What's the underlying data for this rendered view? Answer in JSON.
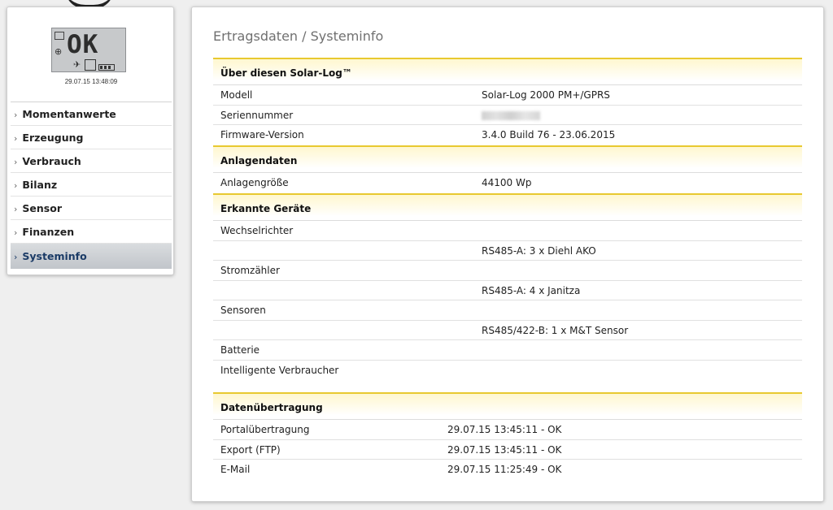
{
  "lcd": {
    "display_text": "OK",
    "timestamp": "29.07.15 13:48:09"
  },
  "nav": {
    "items": [
      {
        "label": "Momentanwerte"
      },
      {
        "label": "Erzeugung"
      },
      {
        "label": "Verbrauch"
      },
      {
        "label": "Bilanz"
      },
      {
        "label": "Sensor"
      },
      {
        "label": "Finanzen"
      },
      {
        "label": "Systeminfo"
      }
    ],
    "active": "Systeminfo",
    "arrow_glyph": "›"
  },
  "page": {
    "title": "Ertragsdaten / Systeminfo"
  },
  "sections": {
    "about": {
      "title": "Über diesen Solar-Log™",
      "rows": [
        {
          "key": "Modell",
          "value": "Solar-Log 2000 PM+/GPRS"
        },
        {
          "key": "Seriennummer",
          "value": ""
        },
        {
          "key": "Firmware-Version",
          "value": "3.4.0 Build 76 - 23.06.2015"
        }
      ]
    },
    "plant": {
      "title": "Anlagendaten",
      "rows": [
        {
          "key": "Anlagengröße",
          "value": "44100 Wp"
        }
      ]
    },
    "devices": {
      "title": "Erkannte Geräte",
      "rows": [
        {
          "key": "Wechselrichter",
          "value": ""
        },
        {
          "key": "",
          "value": "RS485-A: 3 x Diehl AKO"
        },
        {
          "key": "Stromzähler",
          "value": ""
        },
        {
          "key": "",
          "value": "RS485-A: 4 x Janitza"
        },
        {
          "key": "Sensoren",
          "value": ""
        },
        {
          "key": "",
          "value": "RS485/422-B: 1 x M&T Sensor"
        },
        {
          "key": "Batterie",
          "value": ""
        },
        {
          "key": "Intelligente Verbraucher",
          "value": ""
        }
      ]
    },
    "transfer": {
      "title": "Datenübertragung",
      "rows": [
        {
          "key": "Portalübertragung",
          "value": "29.07.15 13:45:11 - OK"
        },
        {
          "key": "Export (FTP)",
          "value": "29.07.15 13:45:11 - OK"
        },
        {
          "key": "E-Mail",
          "value": "29.07.15 11:25:49 - OK"
        }
      ]
    }
  },
  "colors": {
    "section_accent": "#e8c930",
    "active_nav_text": "#1b3b66"
  }
}
